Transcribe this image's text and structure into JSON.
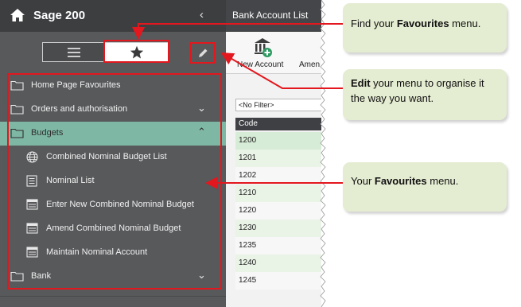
{
  "app": {
    "title": "Sage 200",
    "collapse_glyph": "‹"
  },
  "sidebar": {
    "toggle": {
      "list_icon": "list-view-icon",
      "favourites_icon": "star-icon"
    },
    "edit_icon": "pencil-icon",
    "items": [
      {
        "label": "Home Page Favourites",
        "icon": "folder-icon",
        "level": 0,
        "active": false,
        "chevron": ""
      },
      {
        "label": "Orders and authorisation",
        "icon": "folder-icon",
        "level": 0,
        "active": false,
        "chevron": "⌄"
      },
      {
        "label": "Budgets",
        "icon": "folder-icon",
        "level": 0,
        "active": true,
        "chevron": "⌃"
      },
      {
        "label": "Combined Nominal Budget List",
        "icon": "globe-icon",
        "level": 1,
        "active": false,
        "chevron": ""
      },
      {
        "label": "Nominal List",
        "icon": "list-doc-icon",
        "level": 1,
        "active": false,
        "chevron": ""
      },
      {
        "label": "Enter New Combined Nominal Budget",
        "icon": "form-icon",
        "level": 1,
        "active": false,
        "chevron": ""
      },
      {
        "label": "Amend Combined Nominal Budget",
        "icon": "form-icon",
        "level": 1,
        "active": false,
        "chevron": ""
      },
      {
        "label": "Maintain Nominal Account",
        "icon": "form-icon",
        "level": 1,
        "active": false,
        "chevron": ""
      },
      {
        "label": "Bank",
        "icon": "folder-icon",
        "level": 0,
        "active": false,
        "chevron": "⌄"
      }
    ]
  },
  "main": {
    "title": "Bank Account List",
    "toolbar": {
      "new_account": "New Account",
      "amend": "Amen"
    },
    "filter": "<No Filter>",
    "table": {
      "header": "Code",
      "rows": [
        "1200",
        "1201",
        "1202",
        "1210",
        "1220",
        "1230",
        "1235",
        "1240",
        "1245"
      ]
    }
  },
  "callouts": {
    "favourites": {
      "pre": "Find your ",
      "bold": "Favourites",
      "post": " menu."
    },
    "edit": {
      "pre": "",
      "bold": "Edit",
      "post": " your menu to organise it the way you want."
    },
    "menu": {
      "pre": "Your ",
      "bold": "Favourites",
      "post": " menu."
    }
  },
  "colors": {
    "sidebar_bg": "#58595b",
    "topbar_bg": "#3d3e40",
    "active_item": "#7fb7a5",
    "callout_bg": "#e4ecd1",
    "annotation_red": "#e3171e",
    "row_highlight": "#d6ecd6",
    "row_alt": "#e9f3e6"
  }
}
